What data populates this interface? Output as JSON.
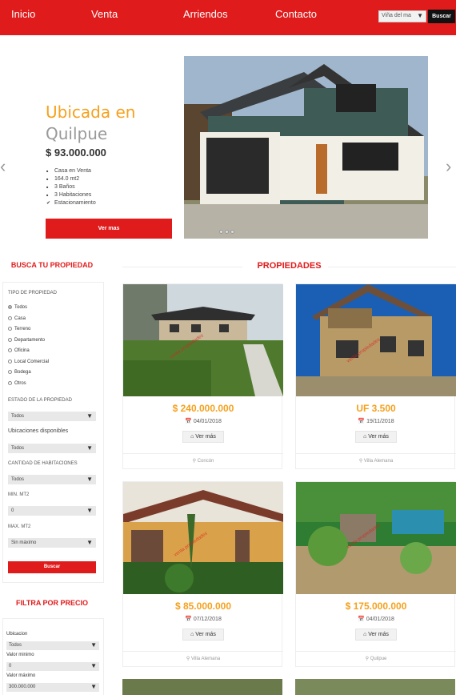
{
  "nav": {
    "links": [
      "Inicio",
      "Venta",
      "Arriendos",
      "Contacto"
    ],
    "city_select": "Viña del ma",
    "search_button": "Buscar",
    "brand_color": "#e01b1b"
  },
  "hero": {
    "title_line1": "Ubicada en",
    "title_line2": "Quilpue",
    "price": "$ 93.000.000",
    "features": [
      "Casa en Venta",
      "164.0 mt2",
      "3 Baños",
      "3 Habitaciones",
      "Estacionamiento"
    ],
    "cta": "Ver mas",
    "prev_arrow": "‹",
    "next_arrow": "›",
    "slides": 3
  },
  "sidebar": {
    "search_title": "BUSCA TU PROPIEDAD",
    "type_label": "TIPO DE PROPIEDAD",
    "types": [
      "Todos",
      "Casa",
      "Terreno",
      "Departamento",
      "Oficina",
      "Local Comercial",
      "Bodega",
      "Otros"
    ],
    "selected_type": "Todos",
    "state_label": "ESTADO DE LA PROPIEDAD",
    "state_value": "Todos",
    "locations_label": "Ubicaciones disponibles",
    "locations_value": "Todos",
    "rooms_label": "CANTIDAD DE HABITACIONES",
    "rooms_value": "Todos",
    "min_label": "MIN. MT2",
    "min_value": "0",
    "max_label": "MAX. MT2",
    "max_value": "Sin máximo",
    "search_button": "Buscar",
    "price_title": "FILTRA POR PRECIO",
    "loc_label": "Ubicacion",
    "loc_value": "Todos",
    "price_min_label": "Valor minimo",
    "price_min_value": "0",
    "price_max_label": "Valor máximo",
    "price_max_value": "300.000.000"
  },
  "listing": {
    "title": "PROPIEDADES",
    "more_label": "Ver más",
    "cards": [
      {
        "price": "$ 240.000.000",
        "date": "04/01/2018",
        "location": "Concón"
      },
      {
        "price": "UF 3.500",
        "date": "19/11/2018",
        "location": "Villa Alemana"
      },
      {
        "price": "$ 85.000.000",
        "date": "07/12/2018",
        "location": "Villa Alemana"
      },
      {
        "price": "$ 175.000.000",
        "date": "04/01/2018",
        "location": "Quilpue"
      }
    ]
  },
  "colors": {
    "accent": "#f5a11d",
    "brand": "#e01b1b"
  }
}
